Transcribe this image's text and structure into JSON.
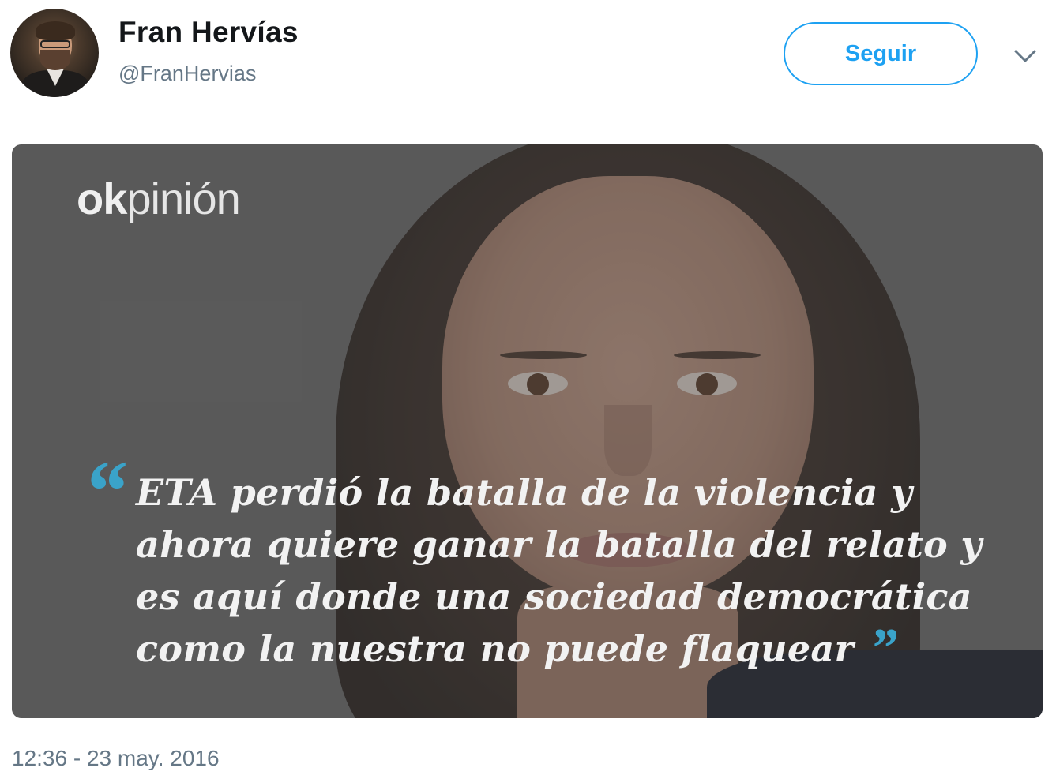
{
  "tweet": {
    "author": {
      "name": "Fran Hervías",
      "handle": "@FranHervias"
    },
    "follow_label": "Seguir",
    "menu_icon": "chevron-down-icon",
    "media": {
      "brand_ok": "ok",
      "brand_rest": "pinión",
      "quote_open": "“",
      "quote_text": "ETA perdió la batalla de la violencia y ahora quiere ganar la batalla del relato y es aquí donde una sociedad democrática como la nuestra no puede flaquear",
      "quote_close": "”"
    },
    "timestamp": "12:36 - 23 may. 2016"
  },
  "colors": {
    "accent": "#1da1f2",
    "quote_mark": "#3aa3c9",
    "secondary_text": "#657786"
  }
}
